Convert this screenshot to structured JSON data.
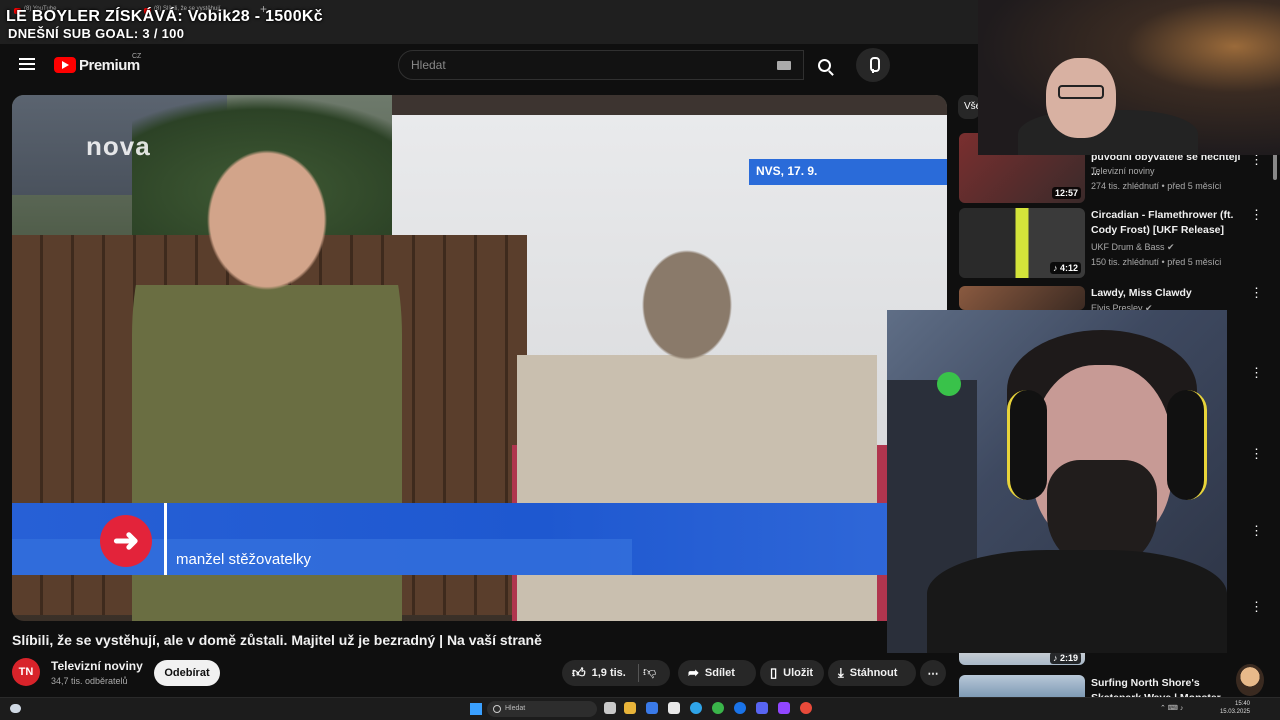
{
  "overlay": {
    "title": "LE BOYLER ZÍSKÁVÁ: Vobik28 - 1500Kč",
    "sub_goal": "DNEŠNÍ SUB GOAL: 3 / 100"
  },
  "browser": {
    "tab1": "(8) YouTube",
    "tab2": "(8) Slíbili, že se vystěhují...",
    "new_tab": "+"
  },
  "masthead": {
    "brand": "Premium",
    "region": "CZ",
    "search_placeholder": "Hledat",
    "icons": {
      "menu": "hamburger-icon",
      "search": "search-icon",
      "mic": "microphone-icon",
      "keyboard": "keyboard-icon"
    }
  },
  "video": {
    "channel_logo": "nova",
    "nvs_label": "NVS, 17. 9.",
    "caption": "manžel stěžovatelky",
    "arrow": "➜"
  },
  "watch": {
    "title": "Slíbili, že se vystěhují, ale v domě zůstali. Majitel už je bezradný | Na vaší straně",
    "channel_name": "Televizní noviny",
    "channel_avatar": "TN",
    "subscribers": "34,7 tis. odběratelů",
    "subscribe_label": "Odebírat",
    "likes": "1,9 tis.",
    "share_label": "Sdílet",
    "save_label": "Uložit",
    "download_label": "Stáhnout",
    "more": "⋯"
  },
  "sidebar": {
    "chip": "Vše",
    "items": [
      {
        "title": "původní obyvatele se nechtějí ...",
        "channel": "Televizní noviny",
        "meta": "274 tis. zhlédnutí • před 5 měsíci",
        "duration": "12:57",
        "thumb_color": "#7a2f2f"
      },
      {
        "title": "Circadian - Flamethrower (ft. Cody Frost) [UKF Release]",
        "channel": "UKF Drum & Bass ✔",
        "meta": "150 tis. zhlédnutí • před 5 měsíci",
        "duration": "♪ 4:12",
        "thumb_color": "#3d3d3d"
      },
      {
        "title": "Lawdy, Miss Clawdy",
        "channel": "Elvis Presley ✔",
        "meta": "",
        "duration": "",
        "thumb_color": "#8a5a40"
      },
      {
        "title": "Surfing North Shore's Skatepark Wave | Monster Wave Collect BA...",
        "channel": "",
        "meta": "",
        "duration": "♪ 2:19",
        "thumb_color": "#6a8aa8"
      }
    ]
  },
  "taskbar": {
    "search_placeholder": "Hledat",
    "time": "15:40",
    "date": "15.03.2025"
  },
  "colors": {
    "accent_red": "#ff0000",
    "lower_third_blue": "#2760d6",
    "nvs_blue": "#2a6bd9",
    "arrow_red": "#e3233a"
  }
}
